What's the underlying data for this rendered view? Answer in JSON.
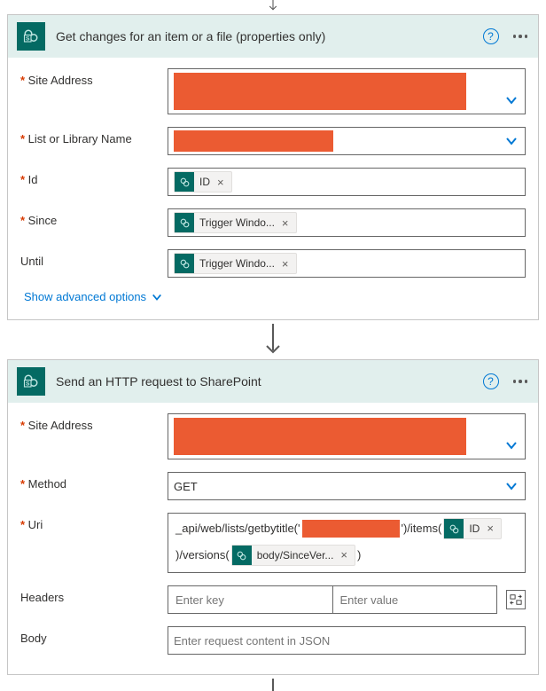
{
  "card1": {
    "title": "Get changes for an item or a file (properties only)",
    "fields": {
      "siteAddress": {
        "label": "Site Address"
      },
      "listName": {
        "label": "List or Library Name"
      },
      "id": {
        "label": "Id",
        "token": "ID"
      },
      "since": {
        "label": "Since",
        "token": "Trigger Windo..."
      },
      "until": {
        "label": "Until",
        "token": "Trigger Windo..."
      }
    },
    "advanced": "Show advanced options"
  },
  "card2": {
    "title": "Send an HTTP request to SharePoint",
    "fields": {
      "siteAddress": {
        "label": "Site Address"
      },
      "method": {
        "label": "Method",
        "value": "GET"
      },
      "uri": {
        "label": "Uri",
        "seg1": "_api/web/lists/getbytitle('",
        "seg2": "')/items(",
        "token2": "ID",
        "seg3": ")/versions(",
        "token3": "body/SinceVer...",
        "seg4": ")"
      },
      "headers": {
        "label": "Headers",
        "keyPH": "Enter key",
        "valPH": "Enter value"
      },
      "body": {
        "label": "Body",
        "placeholder": "Enter request content in JSON"
      }
    }
  },
  "common": {
    "tokenClose": "×"
  }
}
